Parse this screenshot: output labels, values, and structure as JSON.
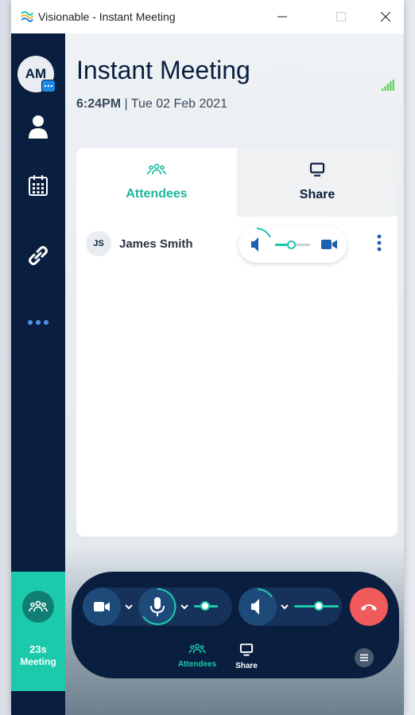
{
  "window": {
    "title": "Visionable - Instant Meeting"
  },
  "sidebar": {
    "avatar_initials": "AM",
    "items": [
      {
        "name": "profile",
        "icon": "person-icon"
      },
      {
        "name": "calendar",
        "icon": "calendar-icon"
      },
      {
        "name": "links",
        "icon": "link-icon"
      },
      {
        "name": "more",
        "icon": "ellipsis-icon"
      }
    ],
    "meeting_tile": {
      "time": "23s",
      "label": "Meeting"
    }
  },
  "header": {
    "title": "Instant Meeting",
    "time": "6:24PM",
    "date": " | Tue 02 Feb 2021"
  },
  "tabs": [
    {
      "label": "Attendees",
      "active": true
    },
    {
      "label": "Share",
      "active": false
    }
  ],
  "attendees": [
    {
      "initials": "JS",
      "name": "James Smith",
      "volume": 0.45
    }
  ],
  "controls": {
    "mic_level": 0.45,
    "speaker_level": 0.55,
    "bottom_tabs": [
      {
        "label": "Attendees",
        "active": true
      },
      {
        "label": "Share",
        "active": false
      }
    ]
  },
  "colors": {
    "navy": "#0a1f3f",
    "teal": "#1cc9aa",
    "end_call": "#f25b5b"
  }
}
